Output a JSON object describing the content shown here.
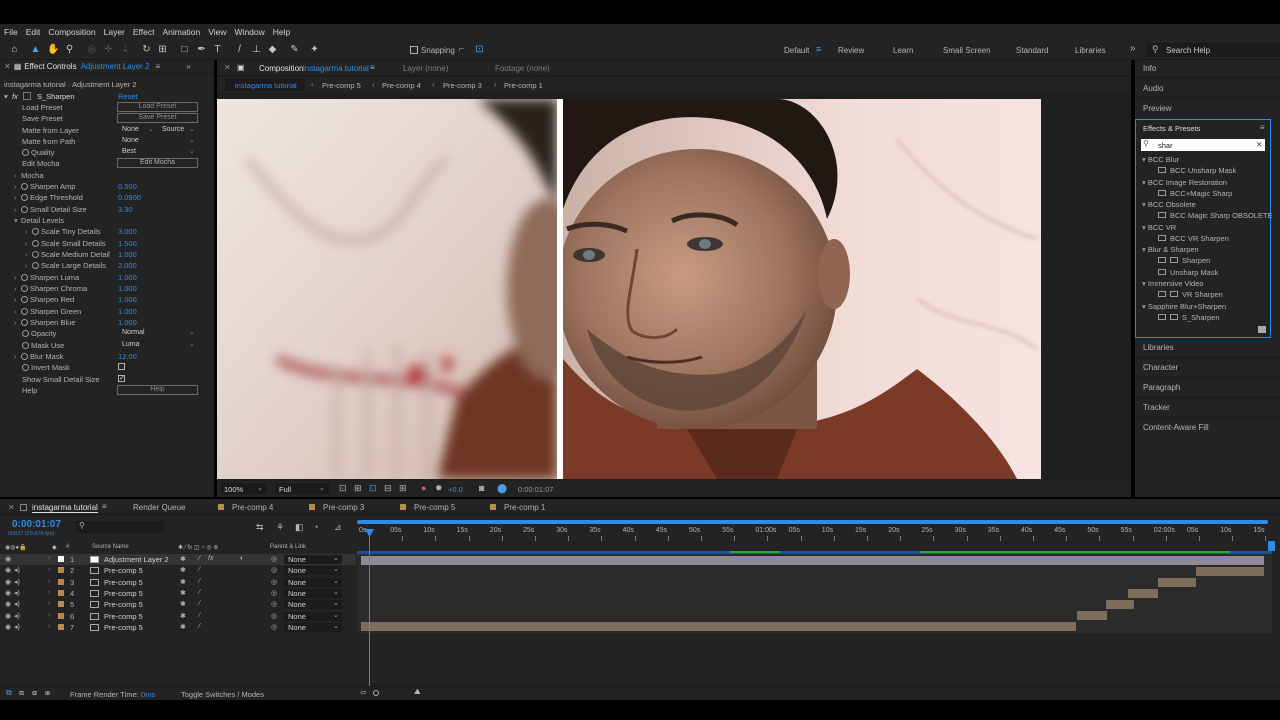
{
  "menu": [
    "File",
    "Edit",
    "Composition",
    "Layer",
    "Effect",
    "Animation",
    "View",
    "Window",
    "Help"
  ],
  "toolbar": {
    "snapping": "Snapping"
  },
  "workspaces": [
    {
      "label": "Default",
      "active": true
    },
    {
      "label": "Review",
      "active": false
    },
    {
      "label": "Learn",
      "active": false
    },
    {
      "label": "Small Screen",
      "active": false
    },
    {
      "label": "Standard",
      "active": false
    },
    {
      "label": "Libraries",
      "active": false
    }
  ],
  "search_help": "Search Help",
  "effect_controls": {
    "tab_label": "Effect Controls",
    "layer_name": "Adjustment Layer 2",
    "breadcrumb": "instagarma tutorial · Adjustment Layer 2",
    "effect_name": "S_Sharpen",
    "reset": "Reset",
    "rows": {
      "load_preset": "Load Preset",
      "load_preset_btn": "Load Preset",
      "save_preset": "Save Preset",
      "save_preset_btn": "Save Preset",
      "matte_layer": "Matte from Layer",
      "matte_layer_val": "None",
      "matte_layer_src": "Source",
      "matte_path": "Matte from Path",
      "matte_path_val": "None",
      "quality": "Quality",
      "quality_val": "Best",
      "edit_mocha": "Edit Mocha",
      "edit_mocha_btn": "Edit Mocha",
      "mocha": "Mocha",
      "sharpen_amp": "Sharpen Amp",
      "sharpen_amp_val": "0.500",
      "edge_threshold": "Edge Threshold",
      "edge_threshold_val": "0.0900",
      "small_detail": "Small Detail Size",
      "small_detail_val": "3.30",
      "detail_levels": "Detail Levels",
      "scale_tiny": "Scale Tiny Details",
      "scale_tiny_val": "3.000",
      "scale_small": "Scale Small Details",
      "scale_small_val": "1.500",
      "scale_medium": "Scale Medium Detail",
      "scale_medium_val": "1.000",
      "scale_large": "Scale Large Details",
      "scale_large_val": "2.000",
      "sharpen_luma": "Sharpen Luma",
      "sharpen_luma_val": "1.000",
      "sharpen_chroma": "Sharpen Chroma",
      "sharpen_chroma_val": "1.000",
      "sharpen_red": "Sharpen Red",
      "sharpen_red_val": "1.000",
      "sharpen_green": "Sharpen Green",
      "sharpen_green_val": "1.000",
      "sharpen_blue": "Sharpen Blue",
      "sharpen_blue_val": "1.000",
      "opacity": "Opacity",
      "opacity_val": "Normal",
      "mask_use": "Mask Use",
      "mask_use_val": "Luma",
      "blur_mask": "Blur Mask",
      "blur_mask_val": "12.00",
      "invert_mask": "Invert Mask",
      "show_small": "Show Small Detail Size",
      "help": "Help",
      "help_btn": "Help"
    }
  },
  "composition": {
    "tab_label": "Composition",
    "comp_name": "instagarma tutorial",
    "layer_tab": "Layer (none)",
    "footage_tab": "Footage (none)",
    "flow": [
      "instagarma tutorial",
      "Pre-comp 5",
      "Pre-comp 4",
      "Pre-comp 3",
      "Pre-comp 1"
    ],
    "zoom": "100%",
    "resolution": "Full",
    "exposure": "+0.0",
    "timecode": "0:00:01:07"
  },
  "right_panels": {
    "info": "Info",
    "audio": "Audio",
    "preview": "Preview",
    "effects_presets": "Effects & Presets",
    "search_value": "shar",
    "tree": [
      {
        "label": "BCC Blur",
        "type": "cat"
      },
      {
        "label": "BCC Unsharp Mask",
        "type": "fx"
      },
      {
        "label": "BCC Image Restoration",
        "type": "cat"
      },
      {
        "label": "BCC+Magic Sharp",
        "type": "fx"
      },
      {
        "label": "BCC Obsolete",
        "type": "cat"
      },
      {
        "label": "BCC Magic Sharp OBSOLETE",
        "type": "fx"
      },
      {
        "label": "BCC VR",
        "type": "cat"
      },
      {
        "label": "BCC VR Sharpen",
        "type": "fx"
      },
      {
        "label": "Blur & Sharpen",
        "type": "cat"
      },
      {
        "label": "Sharpen",
        "type": "fx"
      },
      {
        "label": "Unsharp Mask",
        "type": "fx"
      },
      {
        "label": "Immersive Video",
        "type": "cat"
      },
      {
        "label": "VR Sharpen",
        "type": "fx"
      },
      {
        "label": "Sapphire Blur+Sharpen",
        "type": "cat"
      },
      {
        "label": "S_Sharpen",
        "type": "fx"
      }
    ],
    "libraries": "Libraries",
    "character": "Character",
    "paragraph": "Paragraph",
    "tracker": "Tracker",
    "content_aware": "Content-Aware Fill"
  },
  "timeline": {
    "tabs": [
      "instagarma tutorial",
      "Render Queue",
      "Pre-comp 4",
      "Pre-comp 3",
      "Pre-comp 5",
      "Pre-comp 1"
    ],
    "timecode": "0:00:01:07",
    "frame_info": "00037 (29.976 fps)",
    "col_source": "Source Name",
    "col_parent": "Parent & Link",
    "ruler": [
      "0s",
      "05s",
      "10s",
      "15s",
      "20s",
      "25s",
      "30s",
      "35s",
      "40s",
      "45s",
      "50s",
      "55s",
      "01:00s",
      "05s",
      "10s",
      "15s",
      "20s",
      "25s",
      "30s",
      "35s",
      "40s",
      "45s",
      "50s",
      "55s",
      "02:00s",
      "05s",
      "10s",
      "15s"
    ],
    "layers": [
      {
        "num": "1",
        "name": "Adjustment Layer 2",
        "parent": "None"
      },
      {
        "num": "2",
        "name": "Pre-comp 5",
        "parent": "None"
      },
      {
        "num": "3",
        "name": "Pre-comp 5",
        "parent": "None"
      },
      {
        "num": "4",
        "name": "Pre-comp 5",
        "parent": "None"
      },
      {
        "num": "5",
        "name": "Pre-comp 5",
        "parent": "None"
      },
      {
        "num": "6",
        "name": "Pre-comp 5",
        "parent": "None"
      },
      {
        "num": "7",
        "name": "Pre-comp 5",
        "parent": "None"
      }
    ],
    "render_time_label": "Frame Render Time:",
    "render_time_value": "0ms",
    "toggle_label": "Toggle Switches / Modes"
  },
  "colors": {
    "accent": "#2d8ceb",
    "panel": "#232323",
    "adjustment_bar": "#8f8b96",
    "precomp_bar": "#7c6e5a"
  }
}
